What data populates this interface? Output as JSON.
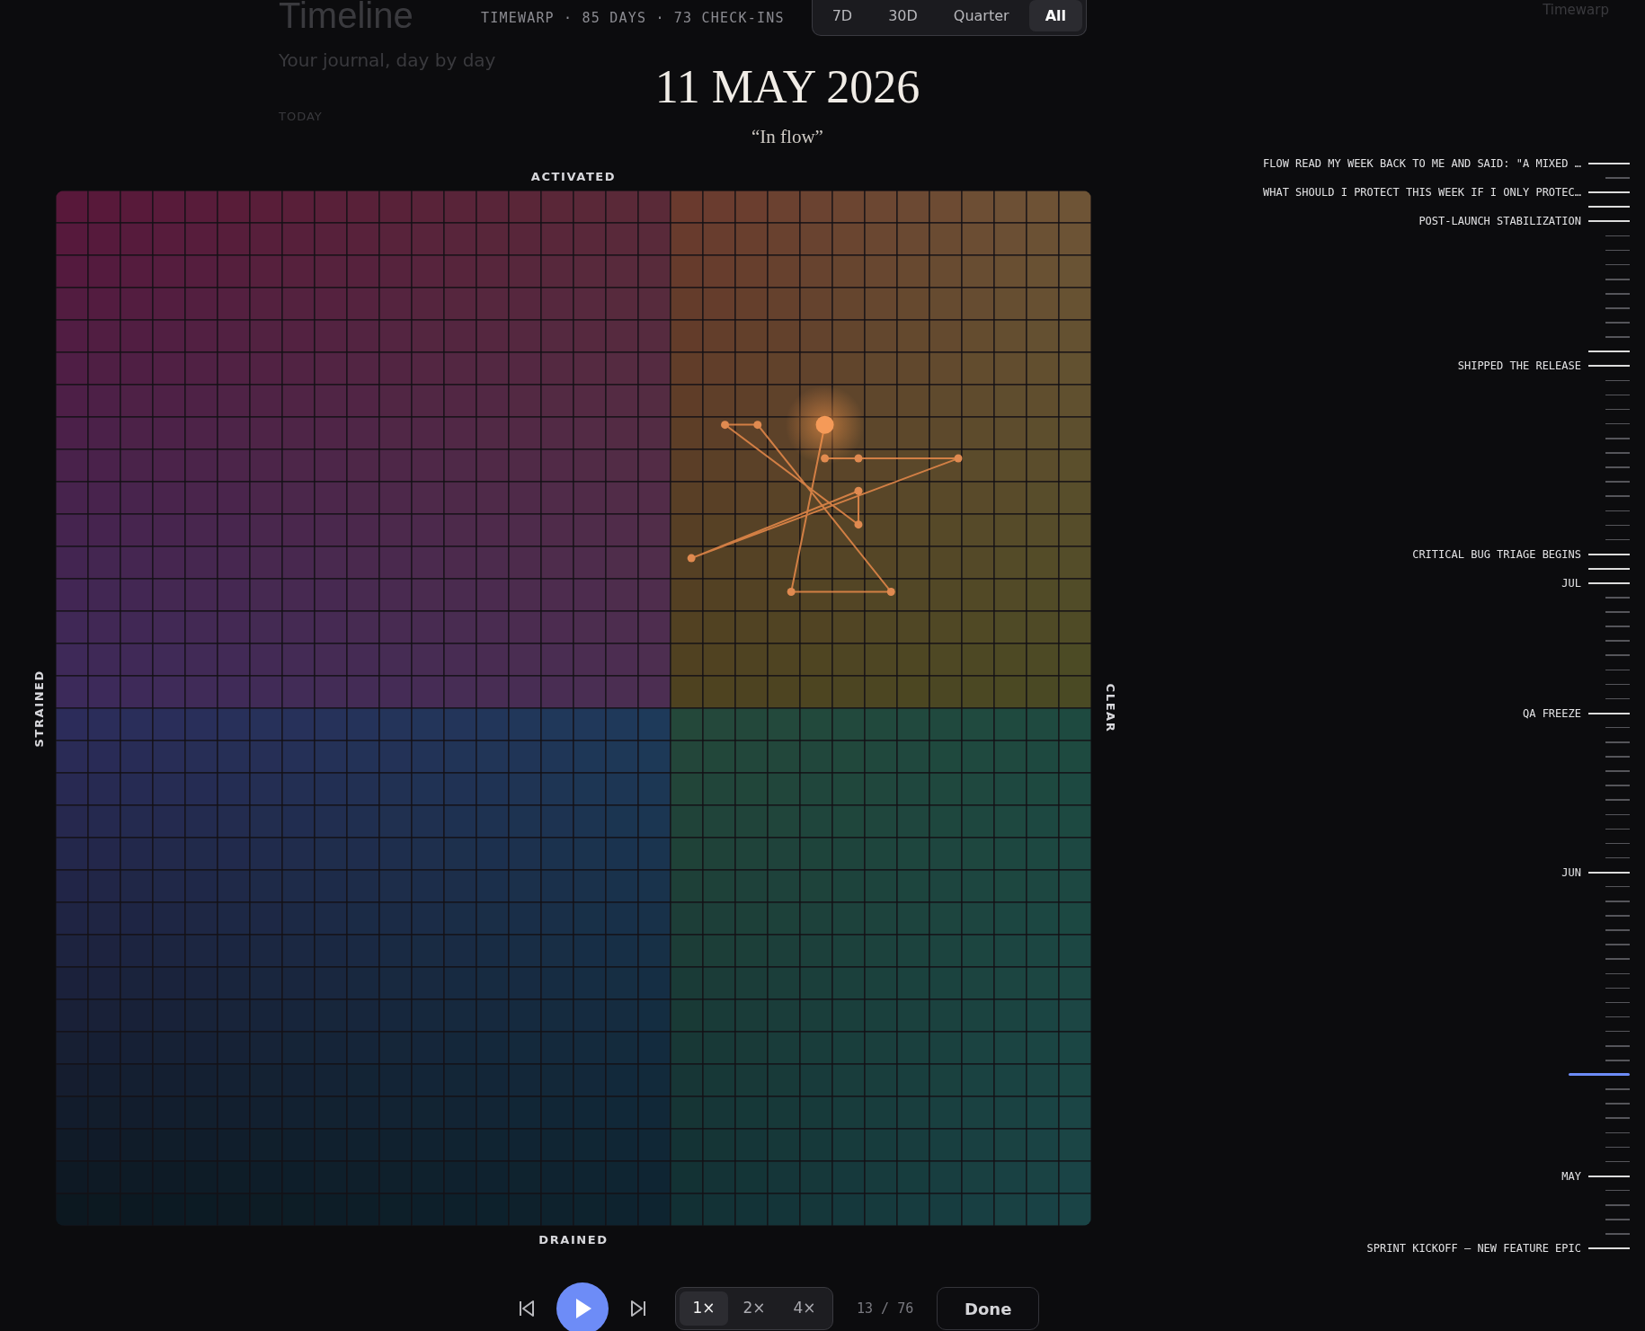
{
  "background": {
    "title": "Timeline",
    "subtitle": "Your journal, day by day",
    "section": "TODAY",
    "brand": "Timewarp"
  },
  "header": {
    "stats": "TIMEWARP · 85 DAYS · 73 CHECK-INS",
    "ranges": [
      {
        "label": "7D",
        "selected": false
      },
      {
        "label": "30D",
        "selected": false
      },
      {
        "label": "Quarter",
        "selected": false
      },
      {
        "label": "All",
        "selected": true
      }
    ]
  },
  "date": "11 MAY 2026",
  "mood": "“In flow”",
  "grid": {
    "axis_top": "ACTIVATED",
    "axis_bottom": "DRAINED",
    "axis_left": "STRAINED",
    "axis_right": "CLEAR"
  },
  "timeline": {
    "ticks": [
      {
        "kind": "labeled",
        "label": "FLOW READ MY WEEK BACK TO ME AND SAID: \"A MIXED …",
        "selected": false
      },
      {
        "kind": "minor",
        "selected": false
      },
      {
        "kind": "labeled",
        "label": "WHAT SHOULD I PROTECT THIS WEEK IF I ONLY PROTEC…",
        "selected": false
      },
      {
        "kind": "major",
        "selected": false
      },
      {
        "kind": "labeled",
        "label": "POST-LAUNCH STABILIZATION",
        "selected": false
      },
      {
        "kind": "minor",
        "selected": false
      },
      {
        "kind": "minor",
        "selected": false
      },
      {
        "kind": "minor",
        "selected": false
      },
      {
        "kind": "minor",
        "selected": false
      },
      {
        "kind": "minor",
        "selected": false
      },
      {
        "kind": "minor",
        "selected": false
      },
      {
        "kind": "minor",
        "selected": false
      },
      {
        "kind": "minor",
        "selected": false
      },
      {
        "kind": "major",
        "selected": false
      },
      {
        "kind": "labeled",
        "label": "SHIPPED THE RELEASE",
        "selected": false
      },
      {
        "kind": "minor",
        "selected": false
      },
      {
        "kind": "minor",
        "selected": false
      },
      {
        "kind": "minor",
        "selected": false
      },
      {
        "kind": "minor",
        "selected": false
      },
      {
        "kind": "minor",
        "selected": false
      },
      {
        "kind": "minor",
        "selected": false
      },
      {
        "kind": "minor",
        "selected": false
      },
      {
        "kind": "minor",
        "selected": false
      },
      {
        "kind": "minor",
        "selected": false
      },
      {
        "kind": "minor",
        "selected": false
      },
      {
        "kind": "minor",
        "selected": false
      },
      {
        "kind": "minor",
        "selected": false
      },
      {
        "kind": "labeled",
        "label": "CRITICAL BUG TRIAGE BEGINS",
        "selected": false
      },
      {
        "kind": "major",
        "selected": false
      },
      {
        "kind": "labeled",
        "label": "JUL",
        "selected": false
      },
      {
        "kind": "minor",
        "selected": false
      },
      {
        "kind": "minor",
        "selected": false
      },
      {
        "kind": "minor",
        "selected": false
      },
      {
        "kind": "minor",
        "selected": false
      },
      {
        "kind": "minor",
        "selected": false
      },
      {
        "kind": "minor",
        "selected": false
      },
      {
        "kind": "minor",
        "selected": false
      },
      {
        "kind": "minor",
        "selected": false
      },
      {
        "kind": "labeled",
        "label": "QA FREEZE",
        "selected": false
      },
      {
        "kind": "minor",
        "selected": false
      },
      {
        "kind": "minor",
        "selected": false
      },
      {
        "kind": "minor",
        "selected": false
      },
      {
        "kind": "minor",
        "selected": false
      },
      {
        "kind": "minor",
        "selected": false
      },
      {
        "kind": "minor",
        "selected": false
      },
      {
        "kind": "minor",
        "selected": false
      },
      {
        "kind": "minor",
        "selected": false
      },
      {
        "kind": "minor",
        "selected": false
      },
      {
        "kind": "minor",
        "selected": false
      },
      {
        "kind": "labeled",
        "label": "JUN",
        "selected": false
      },
      {
        "kind": "minor",
        "selected": false
      },
      {
        "kind": "minor",
        "selected": false
      },
      {
        "kind": "minor",
        "selected": false
      },
      {
        "kind": "minor",
        "selected": false
      },
      {
        "kind": "minor",
        "selected": false
      },
      {
        "kind": "minor",
        "selected": false
      },
      {
        "kind": "minor",
        "selected": false
      },
      {
        "kind": "minor",
        "selected": false
      },
      {
        "kind": "minor",
        "selected": false
      },
      {
        "kind": "minor",
        "selected": false
      },
      {
        "kind": "minor",
        "selected": false
      },
      {
        "kind": "minor",
        "selected": false
      },
      {
        "kind": "minor",
        "selected": false
      },
      {
        "kind": "minor",
        "selected": true
      },
      {
        "kind": "minor",
        "selected": false
      },
      {
        "kind": "minor",
        "selected": false
      },
      {
        "kind": "minor",
        "selected": false
      },
      {
        "kind": "minor",
        "selected": false
      },
      {
        "kind": "minor",
        "selected": false
      },
      {
        "kind": "minor",
        "selected": false
      },
      {
        "kind": "labeled",
        "label": "MAY",
        "selected": false
      },
      {
        "kind": "minor",
        "selected": false
      },
      {
        "kind": "minor",
        "selected": false
      },
      {
        "kind": "minor",
        "selected": false
      },
      {
        "kind": "minor",
        "selected": false
      },
      {
        "kind": "labeled",
        "label": "SPRINT KICKOFF — NEW FEATURE EPIC",
        "selected": false
      }
    ]
  },
  "playback": {
    "playing": false,
    "speeds": [
      {
        "label": "1×",
        "selected": true
      },
      {
        "label": "2×",
        "selected": false
      },
      {
        "label": "4×",
        "selected": false
      }
    ],
    "counter": "13 / 76",
    "done": "Done"
  }
}
